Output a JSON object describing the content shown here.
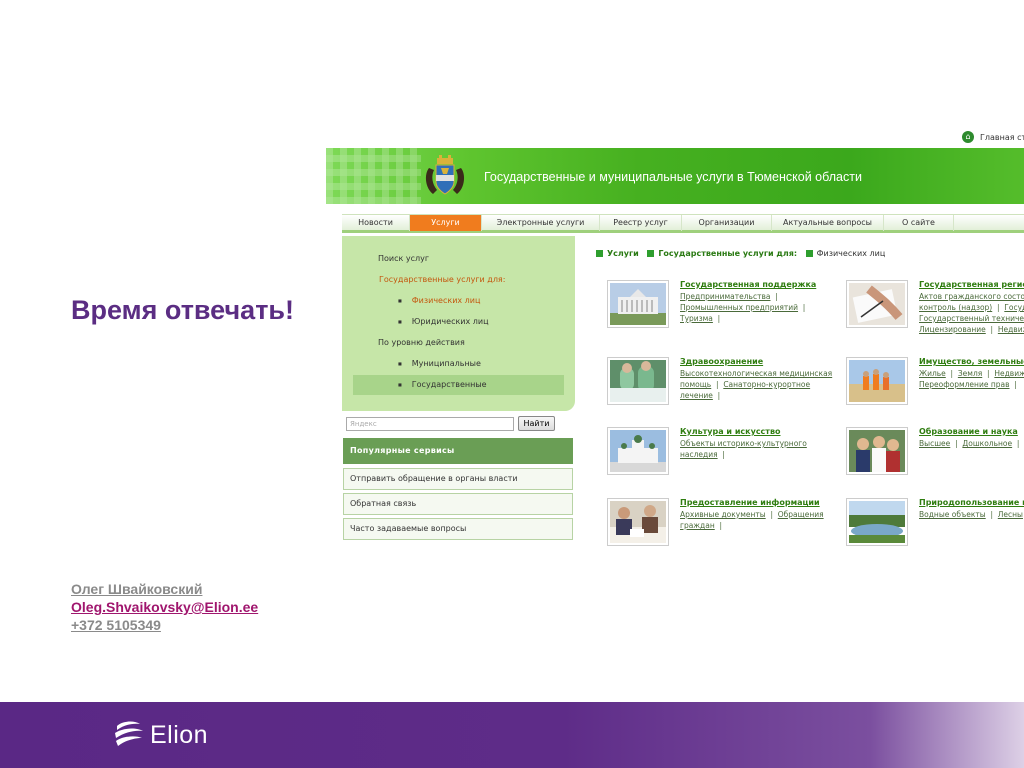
{
  "slide": {
    "title": "Время отвечать!",
    "contact": {
      "name": "Олег Швайковский",
      "email": "Oleg.Shvaikovsky@Elion.ee",
      "phone": "+372 5105349"
    },
    "brand": "Elion",
    "colors": {
      "title": "#5b2d83",
      "footer": "#5a2885",
      "email": "#a0166e"
    }
  },
  "screenshot": {
    "home_link": "Главная стр",
    "header_title": "Государственные и муниципальные услуги в Тюменской области",
    "nav": [
      "Новости",
      "Услуги",
      "Электронные услуги",
      "Реестр услуг",
      "Организации",
      "Актуальные вопросы",
      "О сайте"
    ],
    "nav_active": "Услуги",
    "sidebar": {
      "search_services": "Поиск услуг",
      "gov_services_for": "Государственные услуги для:",
      "individuals": "Физических лиц",
      "legal_entities": "Юридических лиц",
      "by_level": "По уровню действия",
      "municipal": "Муниципальные",
      "state": "Государственные"
    },
    "search": {
      "placeholder": "Яндекс",
      "button": "Найти"
    },
    "popular": {
      "heading": "Популярные сервисы",
      "items": [
        "Отправить обращение в органы власти",
        "Обратная связь",
        "Часто задаваемые вопросы"
      ]
    },
    "breadcrumb": {
      "c1": "Услуги",
      "c2": "Государственные услуги для:",
      "c3": "Физических лиц"
    },
    "tiles": [
      {
        "title": "Государственная поддержка",
        "l1": "Предпринимательства",
        "l2": "Промышленных предприятий",
        "l3": "Туризма"
      },
      {
        "title": "Государственная регист",
        "l1": "Актов гражданского состоя",
        "l2": "контроль (надзор)",
        "l2b": "Госуд",
        "l3": "Государственный технически",
        "l4": "Лицензирование",
        "l4b": "Недвиж"
      },
      {
        "title": "Здравоохранение",
        "l1": "Высокотехнологическая медицинская",
        "l2": "помощь",
        "l2b": "Санаторно-курортное",
        "l3": "лечение"
      },
      {
        "title": "Имущество, земельные",
        "l1": "Жилье",
        "l1b": "Земля",
        "l1c": "Недвиж",
        "l2": "Переоформление прав"
      },
      {
        "title": "Культура и искусство",
        "l1": "Объекты историко-культурного",
        "l2": "наследия"
      },
      {
        "title": "Образование и наука",
        "l1": "Высшее",
        "l1b": "Дошкольное"
      },
      {
        "title": "Предоставление информации",
        "l1": "Архивные документы",
        "l1b": "Обращения",
        "l2": "граждан"
      },
      {
        "title": "Природопользование и з",
        "l1": "Водные объекты",
        "l1b": "Лесны"
      }
    ]
  }
}
